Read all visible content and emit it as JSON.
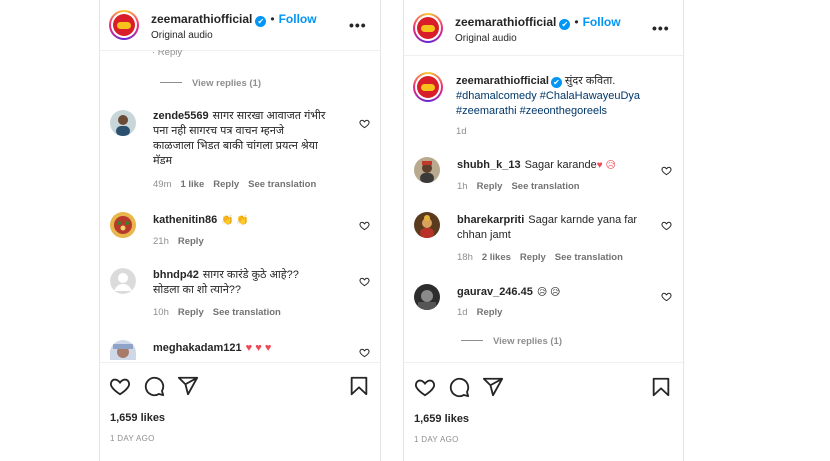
{
  "left_post": {
    "header": {
      "username": "zeemarathiofficial",
      "verified_mark": "✔",
      "separator": "•",
      "follow_label": "Follow",
      "subtitle": "Original audio",
      "more_glyph": "•••"
    },
    "partial_top_text": "· Reply",
    "view_replies_label": "View replies (1)",
    "comments": [
      {
        "username": "zende5569",
        "text_line1": "सागर सारखा आवाजत गंभीर",
        "text_line2": "पना नही सागरच पत्र वाचन म्हनजे",
        "text_line3": "काळजाला भिडत बाकी चांगला प्रयत्न श्रेया",
        "text_line4": "मॅडम",
        "time": "49m",
        "likes": "1 like",
        "reply": "Reply",
        "translate": "See translation"
      },
      {
        "username": "kathenitin86",
        "text": "👏 👏",
        "time": "21h",
        "reply": "Reply"
      },
      {
        "username": "bhndp42",
        "text_line1": "सागर कारंडे कुठे आहे??",
        "text_line2": "सोडला का शो त्याने??",
        "time": "10h",
        "reply": "Reply",
        "translate": "See translation"
      },
      {
        "username": "meghakadam121",
        "text": "♥ ♥ ♥"
      }
    ],
    "likes": "1,659 likes",
    "date": "1 DAY AGO"
  },
  "right_post": {
    "header": {
      "username": "zeemarathiofficial",
      "verified_mark": "✔",
      "separator": "•",
      "follow_label": "Follow",
      "subtitle": "Original audio",
      "more_glyph": "•••"
    },
    "caption": {
      "username": "zeemarathiofficial",
      "verified_mark": "✔",
      "text": "सुंदर कविता.",
      "hashtags_line1": "#dhamalcomedy #ChalaHawayeuDya",
      "hashtags_line2": "#zeemarathi #zeeonthegoreels",
      "time": "1d"
    },
    "comments": [
      {
        "username": "shubh_k_13",
        "text": "Sagar karande",
        "emoji": "♥ 😥",
        "time": "1h",
        "reply": "Reply",
        "translate": "See translation"
      },
      {
        "username": "bharekarpriti",
        "text_line1": "Sagar karnde yana far",
        "text_line2": "chhan jamt",
        "time": "18h",
        "likes": "2 likes",
        "reply": "Reply",
        "translate": "See translation"
      },
      {
        "username": "gaurav_246.45",
        "text": "😥 😥",
        "time": "1d",
        "reply": "Reply"
      }
    ],
    "view_replies_label": "View replies (1)",
    "likes": "1,659 likes",
    "date": "1 DAY AGO"
  },
  "icons": {
    "like": "heart-icon",
    "comment": "comment-icon",
    "share": "share-icon",
    "save": "bookmark-icon"
  }
}
